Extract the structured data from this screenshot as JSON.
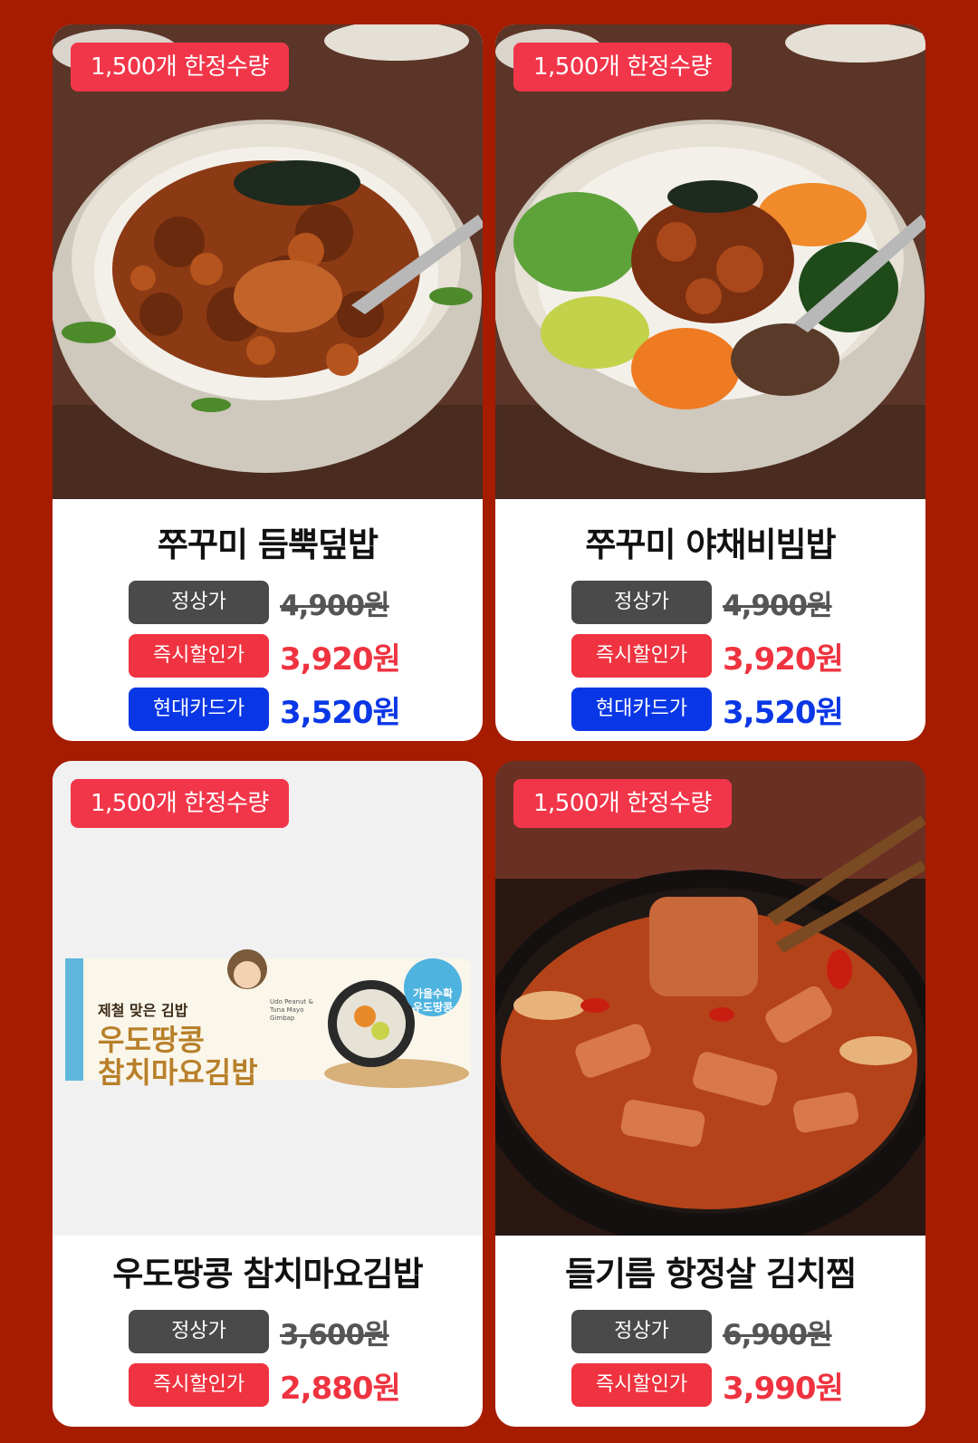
{
  "colors": {
    "background": "#a61c00",
    "badge": "#f2364a",
    "regular_label": "#4a4a4a",
    "discount": "#ef3340",
    "hyundai_card": "#0a37e6"
  },
  "products": [
    {
      "badge": "1,500개 한정수량",
      "name": "쭈꾸미 듬뿍덮밥",
      "regular_label": "정상가",
      "regular_price": "4,900원",
      "discount_label": "즉시할인가",
      "discount_price": "3,920원",
      "card_label": "현대카드가",
      "card_price": "3,520원"
    },
    {
      "badge": "1,500개 한정수량",
      "name": "쭈꾸미 야채비빔밥",
      "regular_label": "정상가",
      "regular_price": "4,900원",
      "discount_label": "즉시할인가",
      "discount_price": "3,920원",
      "card_label": "현대카드가",
      "card_price": "3,520원"
    },
    {
      "badge": "1,500개 한정수량",
      "name": "우도땅콩 참치마요김밥",
      "regular_label": "정상가",
      "regular_price": "3,600원",
      "discount_label": "즉시할인가",
      "discount_price": "2,880원",
      "package": {
        "line1": "제철 맞은 김밥",
        "line2": "우도땅콩",
        "line3": "참치마요김밥",
        "english": "Udo Peanut & Tuna Mayo Gimbap",
        "seal_line1": "가을수확",
        "seal_line2": "우도땅콩"
      }
    },
    {
      "badge": "1,500개 한정수량",
      "name": "들기름 항정살 김치찜",
      "regular_label": "정상가",
      "regular_price": "6,900원",
      "discount_label": "즉시할인가",
      "discount_price": "3,990원"
    }
  ]
}
